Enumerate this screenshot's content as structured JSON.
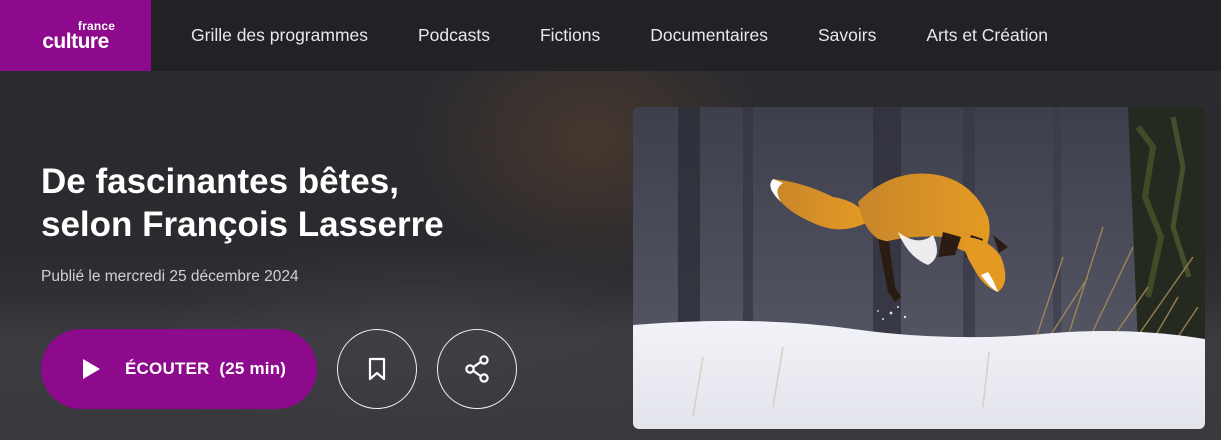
{
  "brand": {
    "line1": "france",
    "line2": "culture"
  },
  "nav": {
    "items": [
      {
        "label": "Grille des programmes"
      },
      {
        "label": "Podcasts"
      },
      {
        "label": "Fictions"
      },
      {
        "label": "Documentaires"
      },
      {
        "label": "Savoirs"
      },
      {
        "label": "Arts et Création"
      }
    ]
  },
  "episode": {
    "title_line1": "De fascinantes bêtes,",
    "title_line2": "selon François Lasserre",
    "published": "Publié le mercredi 25 décembre 2024",
    "listen_label": "ÉCOUTER",
    "duration": "(25 min)"
  },
  "colors": {
    "brand": "#8e0a8c",
    "background": "#26262a"
  },
  "icons": {
    "play": "play-icon",
    "bookmark": "bookmark-icon",
    "share": "share-icon"
  }
}
